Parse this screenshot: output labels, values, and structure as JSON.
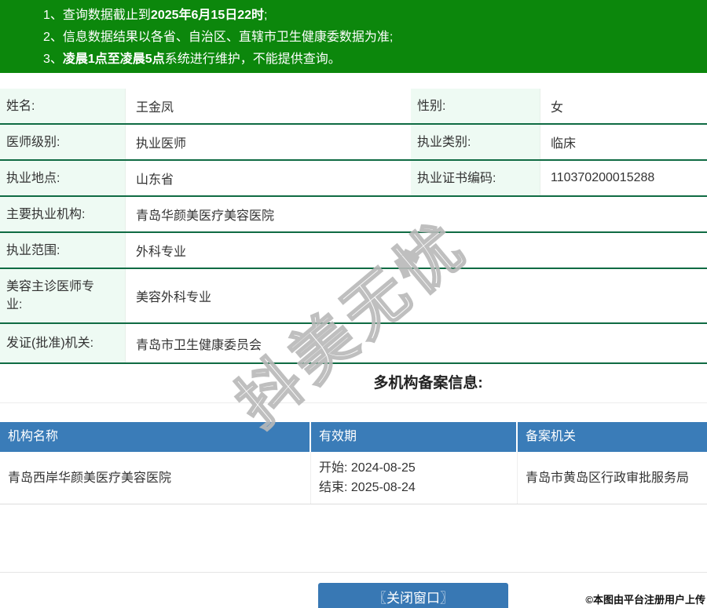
{
  "banner": {
    "notices": [
      {
        "num": "1、",
        "pre": "查询数据截止到",
        "bold": "2025年6月15日22时",
        "post": ";"
      },
      {
        "num": "2、",
        "pre": "信息数据结果以各省、自治区、直辖市卫生健康委数据为准;",
        "bold": "",
        "post": ""
      },
      {
        "num": "3、",
        "pre": "",
        "bold": "凌晨1点至凌晨5点",
        "post": "系统进行维护，不能提供查询。"
      }
    ]
  },
  "doctor_info": {
    "row_name_gender": {
      "label1": "姓名:",
      "value1": "王金凤",
      "label2": "性别:",
      "value2": "女"
    },
    "row_level_category": {
      "label1": "医师级别:",
      "value1": "执业医师",
      "label2": "执业类别:",
      "value2": "临床"
    },
    "row_place_cert": {
      "label1": "执业地点:",
      "value1": "山东省",
      "label2": "执业证书编码:",
      "value2": "110370200015288"
    },
    "row_main_org": {
      "label": "主要执业机构:",
      "value": "青岛华颜美医疗美容医院"
    },
    "row_scope": {
      "label": "执业范围:",
      "value": "外科专业"
    },
    "row_cosmetic_specialty": {
      "label": "美容主诊医师专业:",
      "value": "美容外科专业"
    },
    "row_issuing_authority": {
      "label": "发证(批准)机关:",
      "value": "青岛市卫生健康委员会"
    }
  },
  "multi_org": {
    "section_title": "多机构备案信息:",
    "headers": [
      "机构名称",
      "有效期",
      "备案机关"
    ],
    "row": {
      "org_name": "青岛西岸华颜美医疗美容医院",
      "validity_start_label": "开始:",
      "validity_start": "2024-08-25",
      "validity_end_label": "结束:",
      "validity_end": "2025-08-24",
      "filing_authority": "青岛市黄岛区行政审批服务局"
    }
  },
  "footer": {
    "close_button": "〖关闭窗口〗",
    "copyright": "©本图由平台注册用户上传"
  },
  "watermark": {
    "text": "抖美无忧"
  },
  "colors": {
    "banner_green": "#0c870c",
    "table_border_green": "#0f6b43",
    "label_cell_mint": "#eefaf3",
    "org_header_blue": "#3a7cb8",
    "button_blue": "#3878b4"
  }
}
